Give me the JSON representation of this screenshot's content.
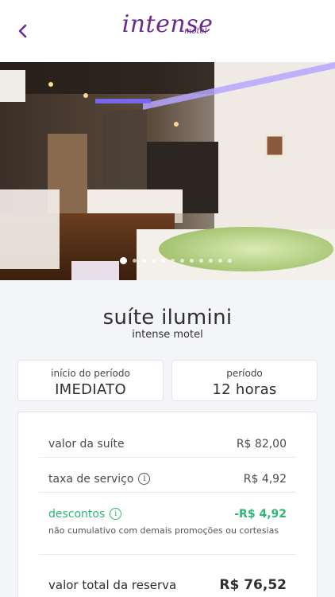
{
  "header": {
    "logo_main": "intense",
    "logo_sub": "motel"
  },
  "gallery": {
    "photo_count": 12,
    "active_index": 0
  },
  "suite": {
    "name": "suíte ilumini",
    "motel": "intense motel"
  },
  "period_start": {
    "label": "início do período",
    "value": "IMEDIATO"
  },
  "period": {
    "label": "período",
    "value": "12 horas"
  },
  "pricing": {
    "suite_label": "valor da suíte",
    "suite_value": "R$ 82,00",
    "service_label": "taxa de serviço",
    "service_value": "R$ 4,92",
    "discount_label": "descontos",
    "discount_value": "-R$ 4,92",
    "discount_note": "não cumulativo com demais promoções ou cortesias",
    "total_label": "valor total da reserva",
    "total_value": "R$ 76,52"
  },
  "colors": {
    "brand": "#6a2a8f",
    "discount": "#2bb673"
  },
  "icons": {
    "back": "chevron-left-icon",
    "info": "info-icon"
  }
}
